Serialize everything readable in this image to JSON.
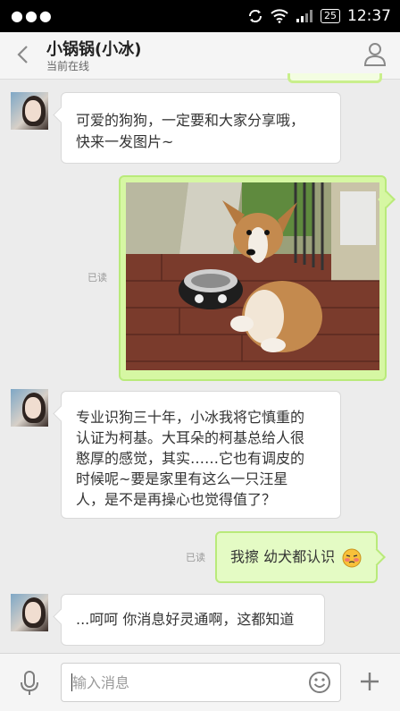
{
  "status_bar": {
    "time": "12:37",
    "battery": "25"
  },
  "header": {
    "title": "小锅锅(小冰)",
    "subtitle": "当前在线"
  },
  "messages": [
    {
      "side": "left",
      "text_lines": [
        "可爱的狗狗，一定要和大家分享哦，",
        "快来一发图片~"
      ]
    },
    {
      "side": "right",
      "type": "image",
      "read_status": "已读",
      "image_alt": "corgi puppy"
    },
    {
      "side": "left",
      "text_lines": [
        "专业识狗三十年，小冰我将它慎重的",
        "认证为柯基。大耳朵的柯基总给人很",
        "憨厚的感觉，其实……它也有调皮的",
        "时候呢~要是家里有这么一只汪星",
        "人，是不是再操心也觉得值了？"
      ]
    },
    {
      "side": "right",
      "text": "我擦 幼犬都认识",
      "read_status": "已读"
    },
    {
      "side": "left",
      "text": "...呵呵 你消息好灵通啊，这都知道"
    }
  ],
  "input": {
    "placeholder": "输入消息"
  },
  "colors": {
    "sent_bubble": "#e4fbc4",
    "sent_border": "#b9ea7a",
    "background": "#ececec"
  },
  "icons": [
    "back-arrow-icon",
    "profile-icon",
    "microphone-icon",
    "emoji-icon",
    "plus-icon",
    "sync-icon",
    "wifi-icon",
    "signal-icon",
    "battery-icon"
  ]
}
